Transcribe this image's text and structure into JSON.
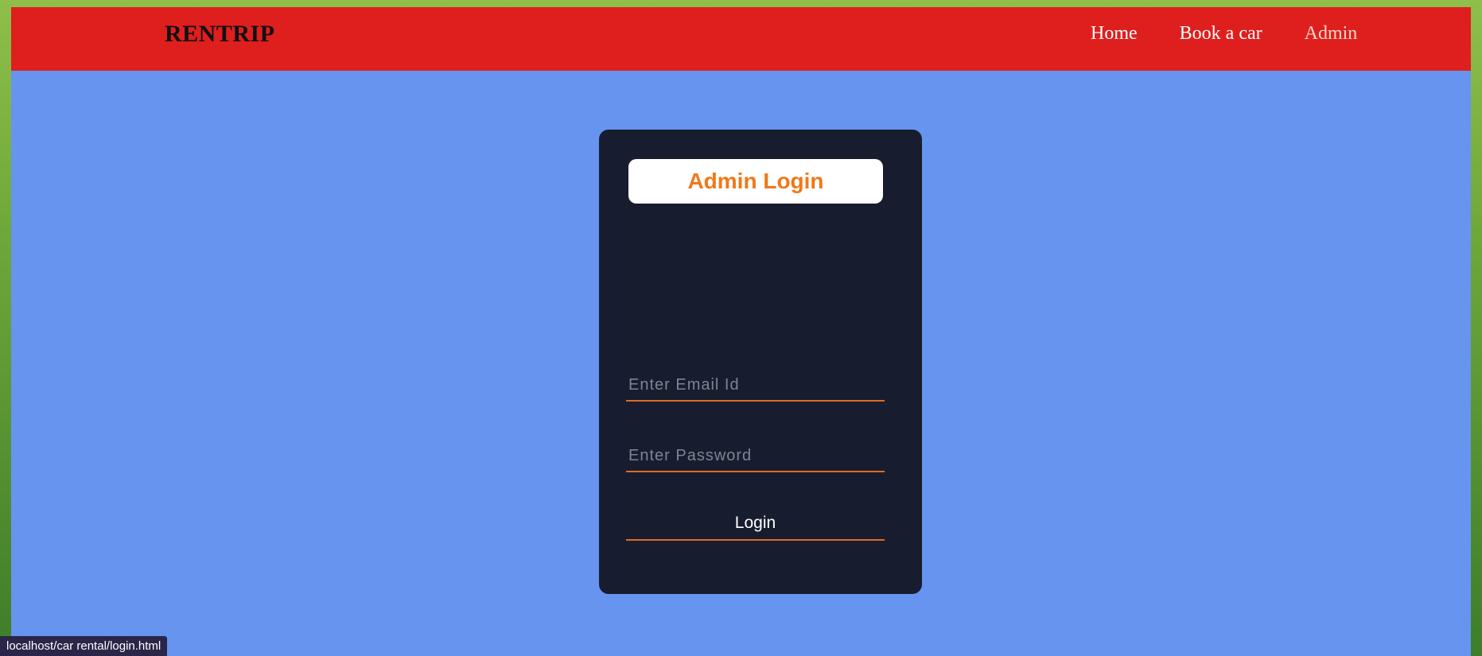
{
  "navbar": {
    "brand": "RENTRIP",
    "links": [
      {
        "label": "Home"
      },
      {
        "label": "Book a car"
      },
      {
        "label": "Admin"
      }
    ]
  },
  "login": {
    "title": "Admin Login",
    "email_placeholder": "Enter Email Id",
    "email_value": "",
    "password_placeholder": "Enter Password",
    "password_value": "",
    "button_label": "Login"
  },
  "status_bar": {
    "url": "localhost/car rental/login.html"
  },
  "colors": {
    "navbar_bg": "#de1f1e",
    "page_bg": "#6694ee",
    "card_bg": "#171d2f",
    "accent_orange": "#f07818",
    "underline": "#e06a25"
  }
}
